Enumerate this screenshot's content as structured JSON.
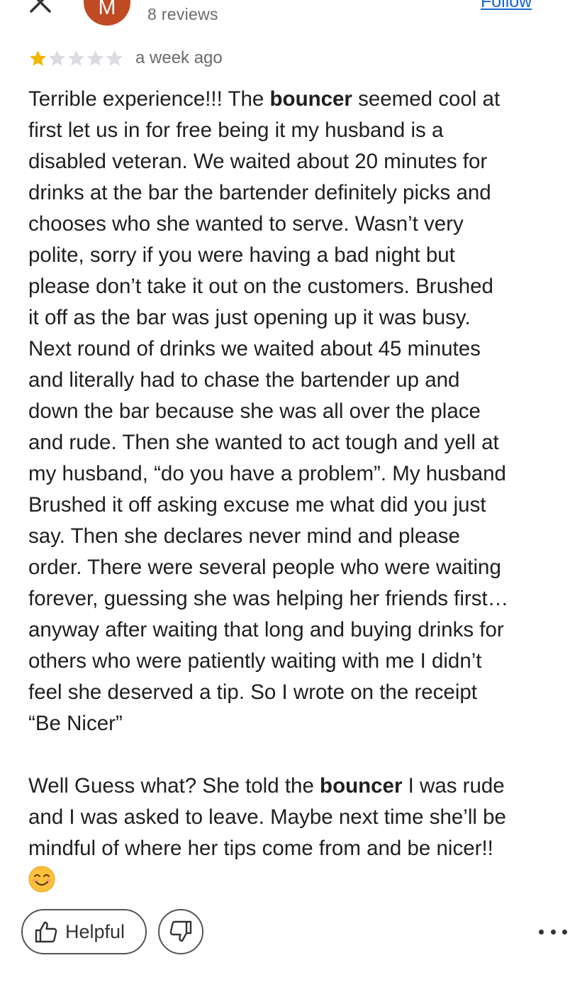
{
  "header": {
    "avatar_initial": "M",
    "reviews_count": "8 reviews",
    "follow_label": "Follow"
  },
  "rating": {
    "stars_filled": 1,
    "stars_total": 5,
    "time_ago": "a week ago"
  },
  "review": {
    "lines": [
      [
        "Terrible experience!!! The ",
        "bouncer",
        " seemed cool at"
      ],
      "first let us in for free being it my husband is a",
      "disabled veteran. We waited about 20 minutes for",
      "drinks at the bar the bartender definitely picks and",
      "chooses who she wanted to serve. Wasn’t very",
      "polite, sorry if you were having a bad night but",
      "please don’t take it out on the customers. Brushed",
      "it off as the bar was just opening up it was busy.",
      "Next round of drinks we waited about 45 minutes",
      "and literally had to chase the bartender up and",
      "down the bar because she was all over the place",
      "and rude. Then she wanted to act tough and yell at",
      "my husband, “do you have a problem”. My husband",
      "Brushed it off asking excuse me what did you just",
      "say. Then she declares never mind and please",
      "order. There were several people who were waiting",
      "forever, guessing she was helping her friends first…",
      "anyway after waiting that long and buying drinks for",
      "others who were patiently waiting with me I didn’t",
      "feel she deserved a tip. So I wrote on the receipt",
      "“Be Nicer”",
      "",
      [
        "Well Guess what? She told the ",
        "bouncer",
        " I was rude"
      ],
      "and I was asked to leave. Maybe next time she’ll be",
      "mindful of where her tips come from and be nicer!!"
    ],
    "emoji": "smiling-face-emoji"
  },
  "actions": {
    "helpful_label": "Helpful"
  },
  "colors": {
    "star_filled": "#f5b400",
    "star_empty": "#dadce0",
    "avatar_bg": "#bf4a24",
    "link": "#1a67d2"
  }
}
